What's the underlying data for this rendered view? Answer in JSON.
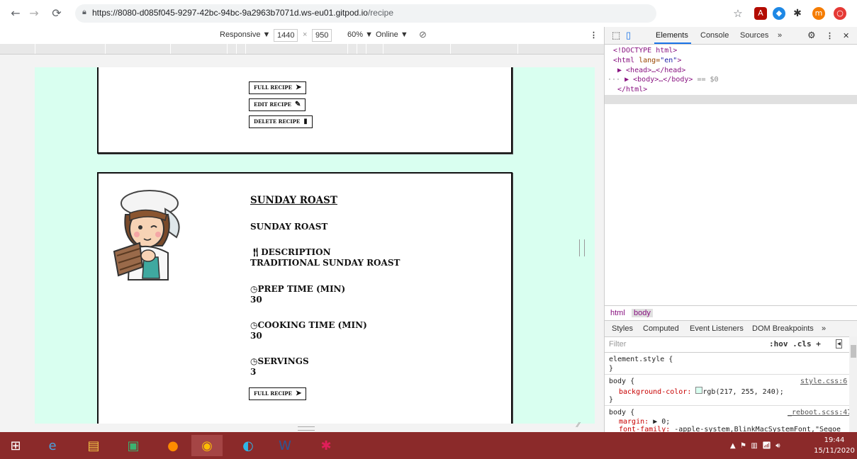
{
  "browser": {
    "url_host": "https://8080-d085f045-9297-42bc-94bc-9a2963b7071d.ws-eu01.gitpod.io",
    "url_path": "/recipe",
    "extensions": [
      "star-icon",
      "acrobat-icon",
      "extension-blue-icon",
      "puzzle-icon",
      "profile-m",
      "opera-icon"
    ],
    "profile_letter": "m"
  },
  "device_toolbar": {
    "mode": "Responsive ▼",
    "width": "1440",
    "x": "×",
    "height": "950",
    "zoom": "60% ▼",
    "network": "Online ▼"
  },
  "recipe_top": {
    "buttons": [
      "FULL RECIPE",
      "EDIT RECIPE",
      "DELETE RECIPE"
    ]
  },
  "recipe_card": {
    "title": "SUNDAY ROAST",
    "name": "SUNDAY ROAST",
    "description_label": "DESCRIPTION",
    "description": "TRADITIONAL SUNDAY ROAST",
    "prep_label": "PREP TIME (MIN)",
    "prep_value": "30",
    "cook_label": "COOKING TIME (MIN)",
    "cook_value": "30",
    "servings_label": "SERVINGS",
    "servings_value": "3",
    "button": "FULL RECIPE"
  },
  "devtools": {
    "tabs": [
      "Elements",
      "Console",
      "Sources",
      "»"
    ],
    "dom": {
      "doctype": "<!DOCTYPE html>",
      "html_open_tag": "<html ",
      "lang_attr": "lang=",
      "lang_value": "\"en\"",
      "html_close_bracket": ">",
      "head": "▶ <head>…</head>",
      "body": "▶ <body>…</body>",
      "body_eq": "== $0",
      "html_close": "</html>"
    },
    "breadcrumbs": [
      "html",
      "body"
    ],
    "styles_tabs": [
      "Styles",
      "Computed",
      "Event Listeners",
      "DOM Breakpoints",
      "»"
    ],
    "filter_placeholder": "Filter",
    "filter_tools": ":hov  .cls  +",
    "rules": {
      "element_style": "element.style {",
      "close": "}",
      "body1_sel": "body {",
      "body1_src": "style.css:6",
      "body1_prop": "background-color:",
      "body1_val": "rgb(217, 255, 240);",
      "body2_sel": "body {",
      "body2_src": "_reboot.scss:47",
      "body2_prop1": "margin:",
      "body2_val1": "▶ 0;",
      "body2_prop2": "font-family:",
      "body2_val2": "-apple-system,BlinkMacSystemFont,\"Segoe"
    }
  },
  "taskbar": {
    "time": "19:44",
    "date": "15/11/2020"
  }
}
